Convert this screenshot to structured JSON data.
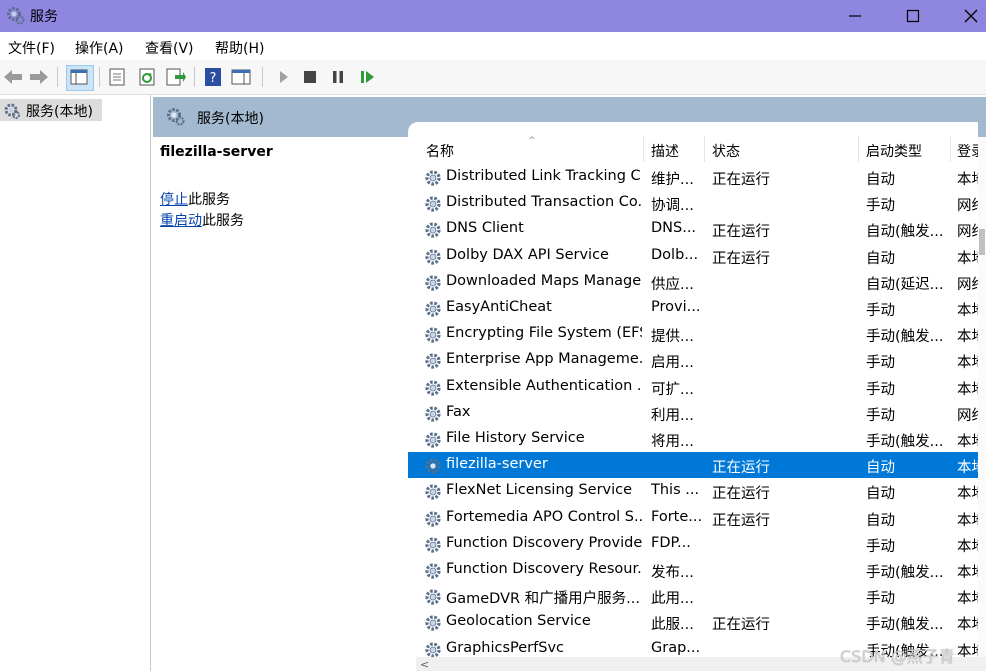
{
  "window": {
    "title": "服务"
  },
  "menu": [
    "文件(F)",
    "操作(A)",
    "查看(V)",
    "帮助(H)"
  ],
  "tree": {
    "root_label": "服务(本地)"
  },
  "panel": {
    "header": "服务(本地)"
  },
  "extended": {
    "service_name": "filezilla-server",
    "stop_link": "停止",
    "stop_suffix": "此服务",
    "restart_link": "重启动",
    "restart_suffix": "此服务"
  },
  "columns": {
    "name": "名称",
    "desc": "描述",
    "status": "状态",
    "startup": "启动类型",
    "logon": "登录"
  },
  "rows": [
    {
      "name": "Distributed Link Tracking C...",
      "desc": "维护...",
      "status": "正在运行",
      "startup": "自动",
      "logon": "本地"
    },
    {
      "name": "Distributed Transaction Co...",
      "desc": "协调...",
      "status": "",
      "startup": "手动",
      "logon": "网络"
    },
    {
      "name": "DNS Client",
      "desc": "DNS...",
      "status": "正在运行",
      "startup": "自动(触发...",
      "logon": "网络"
    },
    {
      "name": "Dolby DAX API Service",
      "desc": "Dolb...",
      "status": "正在运行",
      "startup": "自动",
      "logon": "本地"
    },
    {
      "name": "Downloaded Maps Manager",
      "desc": "供应...",
      "status": "",
      "startup": "自动(延迟...",
      "logon": "网络"
    },
    {
      "name": "EasyAntiCheat",
      "desc": "Provi...",
      "status": "",
      "startup": "手动",
      "logon": "本地"
    },
    {
      "name": "Encrypting File System (EFS)",
      "desc": "提供...",
      "status": "",
      "startup": "手动(触发...",
      "logon": "本地"
    },
    {
      "name": "Enterprise App Manageme...",
      "desc": "启用...",
      "status": "",
      "startup": "手动",
      "logon": "本地"
    },
    {
      "name": "Extensible Authentication ...",
      "desc": "可扩...",
      "status": "",
      "startup": "手动",
      "logon": "本地"
    },
    {
      "name": "Fax",
      "desc": "利用...",
      "status": "",
      "startup": "手动",
      "logon": "网络"
    },
    {
      "name": "File History Service",
      "desc": "将用...",
      "status": "",
      "startup": "手动(触发...",
      "logon": "本地"
    },
    {
      "name": "filezilla-server",
      "desc": "",
      "status": "正在运行",
      "startup": "自动",
      "logon": "本地"
    },
    {
      "name": "FlexNet Licensing Service",
      "desc": "This ...",
      "status": "正在运行",
      "startup": "自动",
      "logon": "本地"
    },
    {
      "name": "Fortemedia APO Control S...",
      "desc": "Forte...",
      "status": "正在运行",
      "startup": "自动",
      "logon": "本地"
    },
    {
      "name": "Function Discovery Provide...",
      "desc": "FDP...",
      "status": "",
      "startup": "手动",
      "logon": "本地"
    },
    {
      "name": "Function Discovery Resour...",
      "desc": "发布...",
      "status": "",
      "startup": "手动(触发...",
      "logon": "本地"
    },
    {
      "name": "GameDVR 和广播用户服务...",
      "desc": "此用...",
      "status": "",
      "startup": "手动",
      "logon": "本地"
    },
    {
      "name": "Geolocation Service",
      "desc": "此服...",
      "status": "正在运行",
      "startup": "手动(触发...",
      "logon": "本地"
    },
    {
      "name": "GraphicsPerfSvc",
      "desc": "Grap...",
      "status": "",
      "startup": "手动(触发...",
      "logon": "本地"
    }
  ],
  "selected_index": 11,
  "watermark": "CSDN @燕子青",
  "colors": {
    "titlebar": "#8f86e0",
    "selection": "#0078d7",
    "panel_header": "#a3b9d0",
    "link": "#0645ad"
  }
}
